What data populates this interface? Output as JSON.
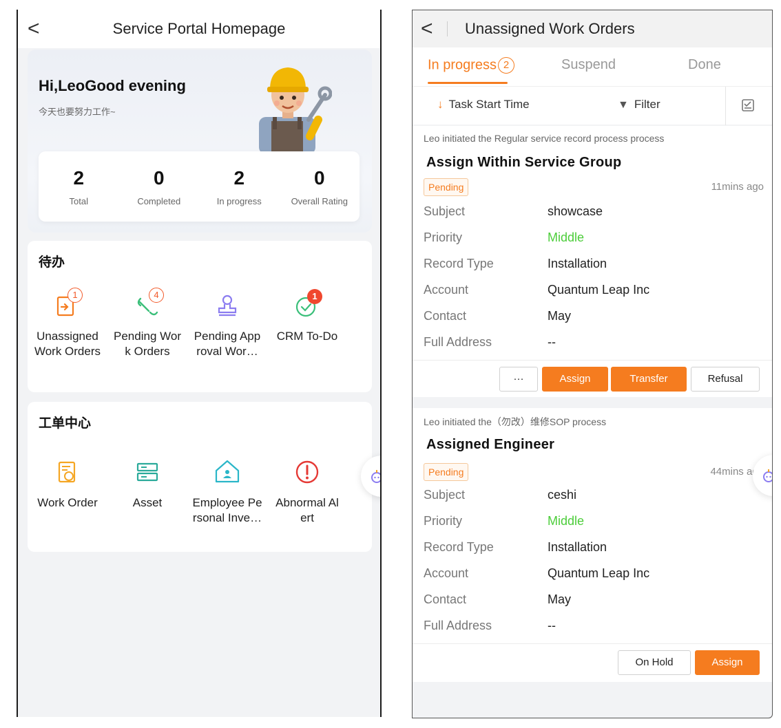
{
  "left": {
    "header": {
      "back": "<",
      "title": "Service Portal Homepage"
    },
    "hero": {
      "greeting": "Hi,LeoGood evening",
      "subtitle": "今天也要努力工作~",
      "stats": [
        {
          "value": "2",
          "label": "Total"
        },
        {
          "value": "0",
          "label": "Completed"
        },
        {
          "value": "2",
          "label": "In progress"
        },
        {
          "value": "0",
          "label": "Overall Rating"
        }
      ]
    },
    "todo": {
      "title": "待办",
      "items": [
        {
          "line1": "Unassigned",
          "line2": "Work Orders",
          "badge": "1",
          "icon": "transfer-doc-icon"
        },
        {
          "line1": "Pending Wor",
          "line2": "k Orders",
          "badge": "4",
          "icon": "wrench-icon"
        },
        {
          "line1": "Pending App",
          "line2": "roval Wor…",
          "badge": "",
          "icon": "stamp-icon"
        },
        {
          "line1": "CRM To-Do",
          "line2": "",
          "badge": "1",
          "icon": "check-circle-icon"
        }
      ]
    },
    "center": {
      "title": "工单中心",
      "items": [
        {
          "line1": "Work Order",
          "line2": "",
          "icon": "work-order-icon"
        },
        {
          "line1": "Asset",
          "line2": "",
          "icon": "asset-icon"
        },
        {
          "line1": "Employee Pe",
          "line2": "rsonal Inve…",
          "icon": "home-person-icon"
        },
        {
          "line1": "Abnormal Al",
          "line2": "ert",
          "icon": "alert-icon"
        }
      ]
    }
  },
  "right": {
    "header": {
      "back": "<",
      "title": "Unassigned Work Orders"
    },
    "tabs": [
      {
        "label": "In progress",
        "count": "2"
      },
      {
        "label": "Suspend"
      },
      {
        "label": "Done"
      }
    ],
    "sortbar": {
      "sort_label": "Task Start Time",
      "filter_label": "Filter"
    },
    "orders": [
      {
        "initiator": "Leo initiated the Regular service record process process",
        "title": "Assign Within Service Group",
        "status": "Pending",
        "time": "11mins ago",
        "fields": [
          {
            "label": "Subject",
            "value": "showcase"
          },
          {
            "label": "Priority",
            "value": "Middle"
          },
          {
            "label": "Record Type",
            "value": "Installation"
          },
          {
            "label": "Account",
            "value": "Quantum Leap Inc"
          },
          {
            "label": "Contact",
            "value": "May"
          },
          {
            "label": "Full Address",
            "value": "--"
          }
        ],
        "buttons": {
          "more": "···",
          "assign": "Assign",
          "transfer": "Transfer",
          "refusal": "Refusal"
        }
      },
      {
        "initiator": "Leo initiated the（勿改）维修SOP process",
        "title": "Assigned Engineer",
        "status": "Pending",
        "time": "44mins ago",
        "fields": [
          {
            "label": "Subject",
            "value": "ceshi"
          },
          {
            "label": "Priority",
            "value": "Middle"
          },
          {
            "label": "Record Type",
            "value": "Installation"
          },
          {
            "label": "Account",
            "value": "Quantum Leap Inc"
          },
          {
            "label": "Contact",
            "value": "May"
          },
          {
            "label": "Full Address",
            "value": "--"
          }
        ],
        "buttons": {
          "on_hold": "On Hold",
          "assign": "Assign"
        }
      }
    ]
  },
  "colors": {
    "accent": "#f57c1f",
    "badge_red": "#f0472e",
    "priority_green": "#4ccd3a"
  }
}
